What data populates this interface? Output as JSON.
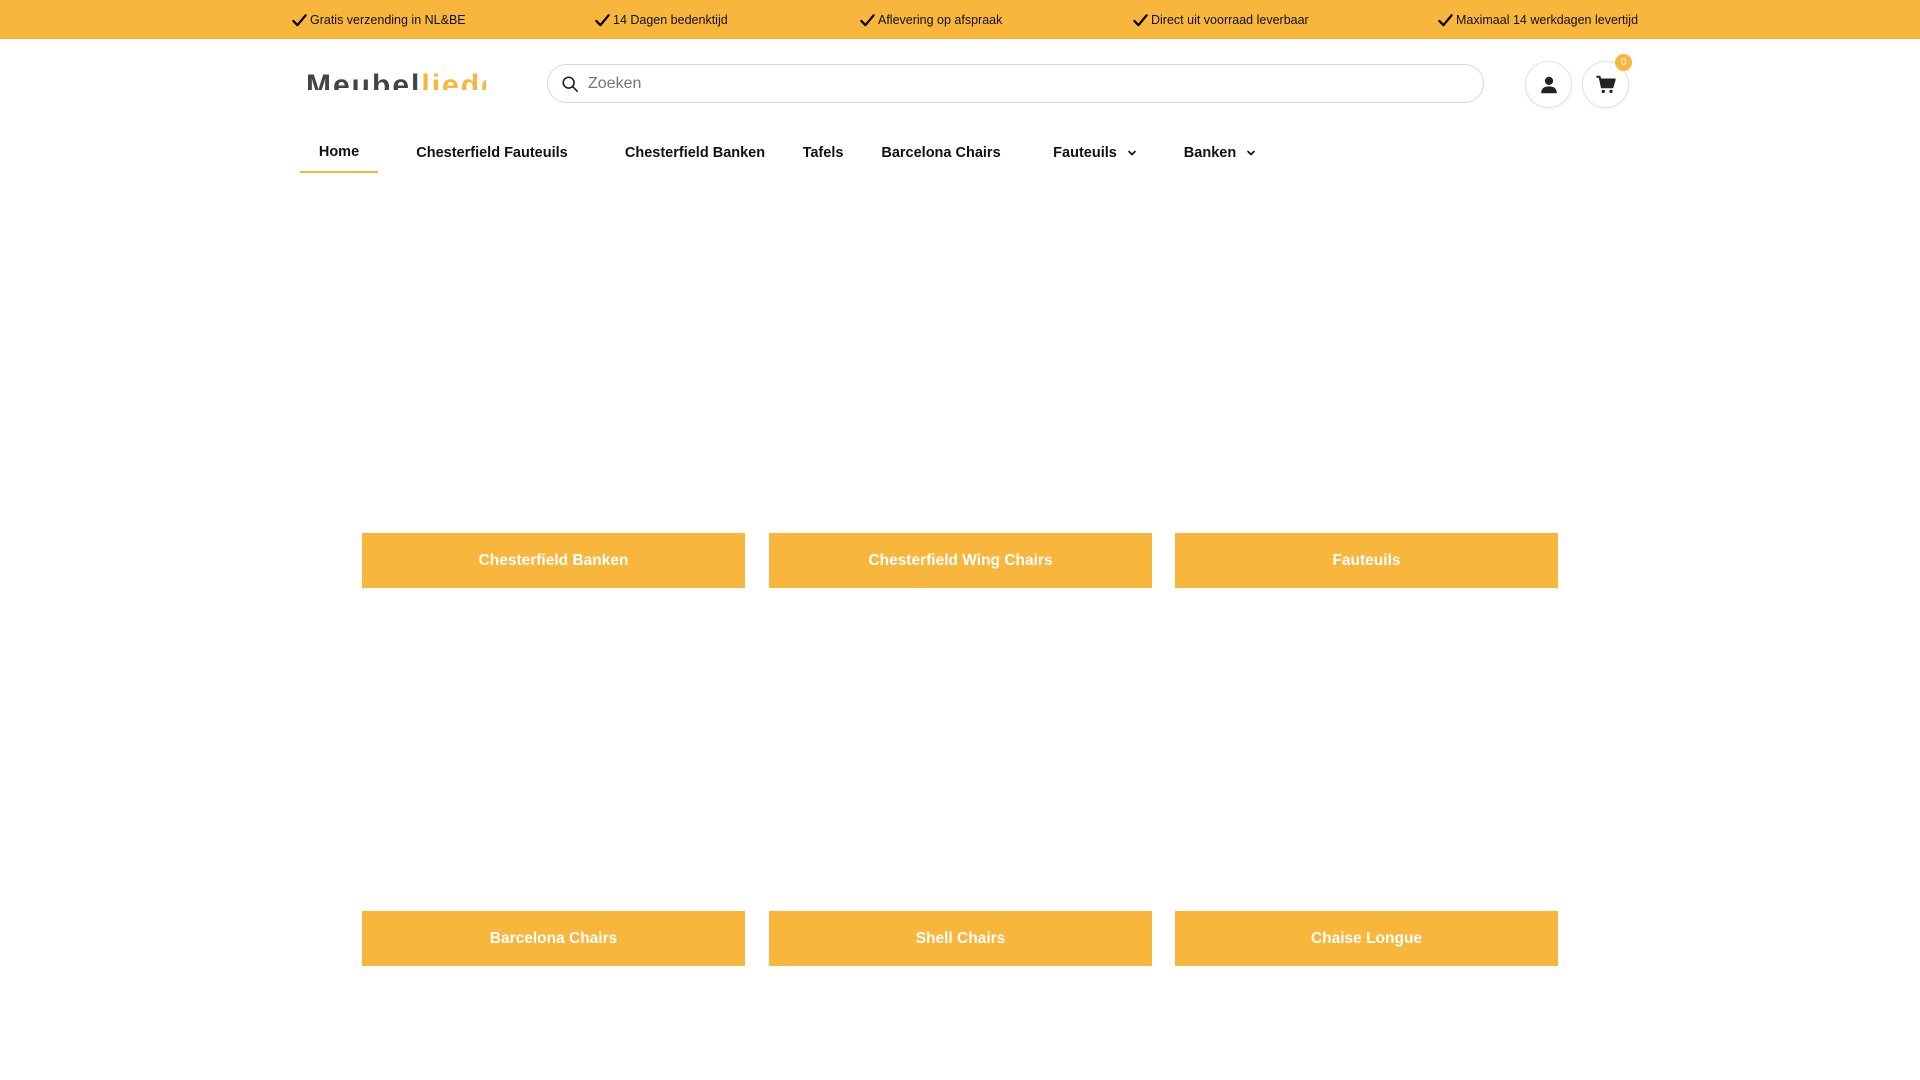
{
  "usp_bar": {
    "items": [
      "Gratis verzending in NL&BE",
      "14 Dagen bedenktijd",
      "Aflevering op afspraak",
      "Direct uit voorraad leverbaar",
      "Maximaal 14 werkdagen levertijd"
    ]
  },
  "header": {
    "logo_part_a": "Meubel",
    "logo_part_b": "lieddde",
    "search_placeholder": "Zoeken",
    "search_value": "",
    "cart_count": "0",
    "account_icon": "user-icon",
    "cart_icon": "cart-icon"
  },
  "nav": {
    "items": [
      {
        "label": "Home",
        "active": true
      },
      {
        "label": "Chesterfield Fauteuils"
      },
      {
        "label": "Chesterfield Banken"
      },
      {
        "label": "Tafels"
      },
      {
        "label": "Barcelona Chairs"
      },
      {
        "label": "Fauteuils",
        "has_dropdown": true
      },
      {
        "label": "Banken",
        "has_dropdown": true
      }
    ]
  },
  "categories": [
    "Chesterfield Banken",
    "Chesterfield Wing Chairs",
    "Fauteuils",
    "Barcelona Chairs",
    "Shell Chairs",
    "Chaise Longue"
  ],
  "colors": {
    "accent": "#f8b63c",
    "text": "#111111"
  }
}
